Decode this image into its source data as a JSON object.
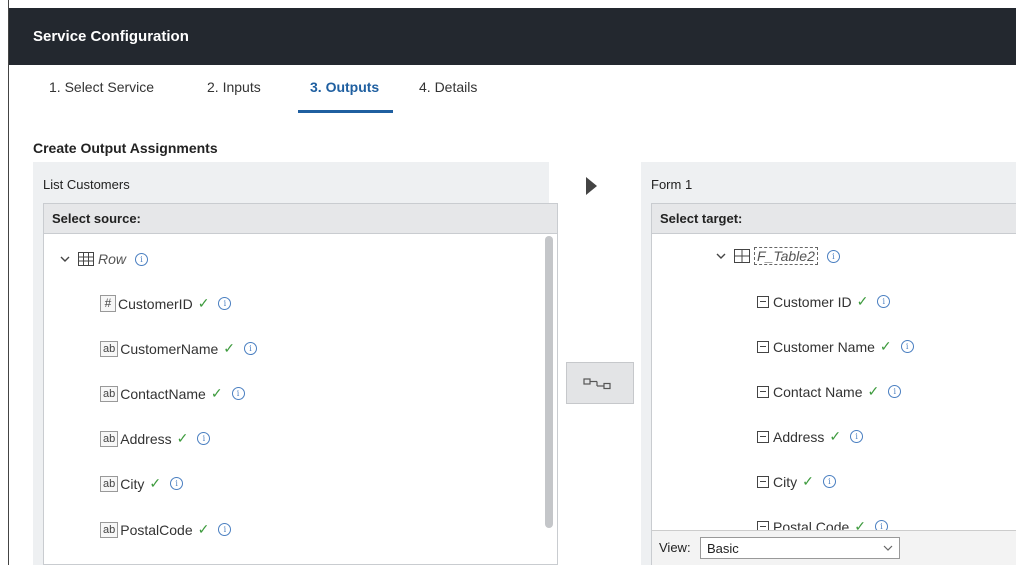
{
  "header": {
    "title": "Service Configuration"
  },
  "tabs": [
    {
      "label": "1. Select Service",
      "active": false
    },
    {
      "label": "2. Inputs",
      "active": false
    },
    {
      "label": "3. Outputs",
      "active": true
    },
    {
      "label": "4. Details",
      "active": false
    }
  ],
  "section_title": "Create Output Assignments",
  "source": {
    "name": "List Customers",
    "header": "Select source:",
    "root": {
      "label": "Row",
      "icon": "table-icon",
      "expanded": true
    },
    "fields": [
      {
        "type_label": "#",
        "icon": "number-type-icon",
        "label": "CustomerID",
        "mapped": true
      },
      {
        "type_label": "ab",
        "icon": "text-type-icon",
        "label": "CustomerName",
        "mapped": true
      },
      {
        "type_label": "ab",
        "icon": "text-type-icon",
        "label": "ContactName",
        "mapped": true
      },
      {
        "type_label": "ab",
        "icon": "text-type-icon",
        "label": "Address",
        "mapped": true
      },
      {
        "type_label": "ab",
        "icon": "text-type-icon",
        "label": "City",
        "mapped": true
      },
      {
        "type_label": "ab",
        "icon": "text-type-icon",
        "label": "PostalCode",
        "mapped": true
      }
    ]
  },
  "target": {
    "name": "Form 1",
    "header": "Select target:",
    "root": {
      "label": "F_Table2",
      "icon": "table-icon",
      "expanded": true
    },
    "fields": [
      {
        "icon": "field-icon",
        "label": "Customer ID",
        "mapped": true
      },
      {
        "icon": "field-icon",
        "label": "Customer Name",
        "mapped": true
      },
      {
        "icon": "field-icon",
        "label": "Contact Name",
        "mapped": true
      },
      {
        "icon": "field-icon",
        "label": "Address",
        "mapped": true
      },
      {
        "icon": "field-icon",
        "label": "City",
        "mapped": true
      },
      {
        "icon": "field-icon",
        "label": "Postal Code",
        "mapped": true
      }
    ],
    "view": {
      "label": "View:",
      "value": "Basic"
    }
  },
  "icons": {
    "check": "✓",
    "info": "i",
    "mapping_button": "map-connector-icon"
  },
  "colors": {
    "header_bg": "#23282f",
    "active_tab": "#1f5fa0",
    "check": "#3e9b3e",
    "info": "#4a7fc1"
  }
}
